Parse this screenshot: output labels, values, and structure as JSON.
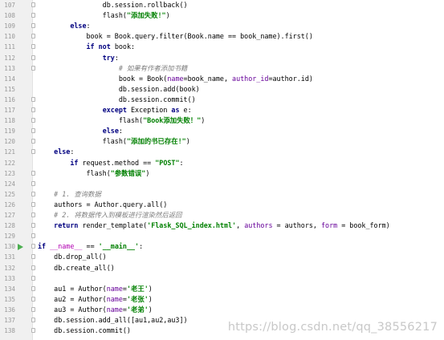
{
  "editor": {
    "lines": [
      {
        "n": "107",
        "tokens": [
          {
            "t": "                db.session.rollback()"
          }
        ]
      },
      {
        "n": "108",
        "tokens": [
          {
            "t": "                flash("
          },
          {
            "t": "\"添加失败!\"",
            "c": "str"
          },
          {
            "t": ")"
          }
        ]
      },
      {
        "n": "109",
        "tokens": [
          {
            "t": "        "
          },
          {
            "t": "else",
            "c": "kw"
          },
          {
            "t": ":"
          }
        ]
      },
      {
        "n": "110",
        "tokens": [
          {
            "t": "            book = Book.query.filter(Book.name == book_name).first()"
          }
        ]
      },
      {
        "n": "111",
        "tokens": [
          {
            "t": "            "
          },
          {
            "t": "if not",
            "c": "kw"
          },
          {
            "t": " book:"
          }
        ]
      },
      {
        "n": "112",
        "tokens": [
          {
            "t": "                "
          },
          {
            "t": "try",
            "c": "kw"
          },
          {
            "t": ":"
          }
        ]
      },
      {
        "n": "113",
        "tokens": [
          {
            "t": "                    "
          },
          {
            "t": "# 如果有作者添加书籍",
            "c": "cmt"
          }
        ]
      },
      {
        "n": "114",
        "tokens": [
          {
            "t": "                    book = Book("
          },
          {
            "t": "name",
            "c": "kwarg"
          },
          {
            "t": "=book_name, "
          },
          {
            "t": "author_id",
            "c": "kwarg"
          },
          {
            "t": "=author.id)"
          }
        ]
      },
      {
        "n": "115",
        "tokens": [
          {
            "t": "                    db.session.add(book)"
          }
        ]
      },
      {
        "n": "116",
        "tokens": [
          {
            "t": "                    db.session.commit()"
          }
        ]
      },
      {
        "n": "117",
        "tokens": [
          {
            "t": "                "
          },
          {
            "t": "except",
            "c": "kw"
          },
          {
            "t": " Exception "
          },
          {
            "t": "as",
            "c": "kw"
          },
          {
            "t": " e:"
          }
        ]
      },
      {
        "n": "118",
        "tokens": [
          {
            "t": "                    flash("
          },
          {
            "t": "\"Book添加失败！\"",
            "c": "str"
          },
          {
            "t": ")"
          }
        ]
      },
      {
        "n": "119",
        "tokens": [
          {
            "t": "                "
          },
          {
            "t": "else",
            "c": "kw"
          },
          {
            "t": ":"
          }
        ]
      },
      {
        "n": "120",
        "tokens": [
          {
            "t": "                flash("
          },
          {
            "t": "\"添加的书已存在!\"",
            "c": "str"
          },
          {
            "t": ")"
          }
        ]
      },
      {
        "n": "121",
        "tokens": [
          {
            "t": "    "
          },
          {
            "t": "else",
            "c": "kw"
          },
          {
            "t": ":"
          }
        ]
      },
      {
        "n": "122",
        "tokens": [
          {
            "t": "        "
          },
          {
            "t": "if",
            "c": "kw"
          },
          {
            "t": " request.method == "
          },
          {
            "t": "\"POST\"",
            "c": "str"
          },
          {
            "t": ":"
          }
        ]
      },
      {
        "n": "123",
        "tokens": [
          {
            "t": "            flash("
          },
          {
            "t": "\"参数错误\"",
            "c": "str"
          },
          {
            "t": ")"
          }
        ]
      },
      {
        "n": "124",
        "tokens": [
          {
            "t": ""
          }
        ]
      },
      {
        "n": "125",
        "tokens": [
          {
            "t": "    "
          },
          {
            "t": "# 1. 查询数据",
            "c": "cmt"
          }
        ]
      },
      {
        "n": "126",
        "tokens": [
          {
            "t": "    authors = Author.query.all()"
          }
        ]
      },
      {
        "n": "127",
        "tokens": [
          {
            "t": "    "
          },
          {
            "t": "# 2. 将数据传入到模板进行渲染然后返回",
            "c": "cmt"
          }
        ]
      },
      {
        "n": "128",
        "tokens": [
          {
            "t": "    "
          },
          {
            "t": "return",
            "c": "kw"
          },
          {
            "t": " render_template("
          },
          {
            "t": "'Flask_SQL_index.html'",
            "c": "str"
          },
          {
            "t": ", "
          },
          {
            "t": "authors",
            "c": "kwarg"
          },
          {
            "t": " = authors, "
          },
          {
            "t": "form",
            "c": "kwarg"
          },
          {
            "t": " = book_form)"
          }
        ]
      },
      {
        "n": "129",
        "tokens": [
          {
            "t": ""
          }
        ]
      },
      {
        "n": "130",
        "tokens": [
          {
            "t": "if",
            "c": "kw"
          },
          {
            "t": " "
          },
          {
            "t": "__name__",
            "c": "dunder"
          },
          {
            "t": " == "
          },
          {
            "t": "'__main__'",
            "c": "str"
          },
          {
            "t": ":"
          }
        ]
      },
      {
        "n": "131",
        "tokens": [
          {
            "t": "    db.drop_all()"
          }
        ]
      },
      {
        "n": "132",
        "tokens": [
          {
            "t": "    db.create_all()"
          }
        ]
      },
      {
        "n": "133",
        "tokens": [
          {
            "t": ""
          }
        ]
      },
      {
        "n": "134",
        "tokens": [
          {
            "t": "    au1 = Author("
          },
          {
            "t": "name",
            "c": "kwarg"
          },
          {
            "t": "="
          },
          {
            "t": "'老王'",
            "c": "str"
          },
          {
            "t": ")"
          }
        ]
      },
      {
        "n": "135",
        "tokens": [
          {
            "t": "    au2 = Author("
          },
          {
            "t": "name",
            "c": "kwarg"
          },
          {
            "t": "="
          },
          {
            "t": "'老张'",
            "c": "str"
          },
          {
            "t": ")"
          }
        ]
      },
      {
        "n": "136",
        "tokens": [
          {
            "t": "    au3 = Author("
          },
          {
            "t": "name",
            "c": "kwarg"
          },
          {
            "t": "="
          },
          {
            "t": "'老弟'",
            "c": "str"
          },
          {
            "t": ")"
          }
        ]
      },
      {
        "n": "137",
        "tokens": [
          {
            "t": "    db.session.add_all([au1,au2,au3])"
          }
        ]
      },
      {
        "n": "138",
        "tokens": [
          {
            "t": "    db.session.commit()"
          }
        ]
      }
    ],
    "run_line": "130",
    "fold_lines": [
      "107",
      "108",
      "109",
      "110",
      "111",
      "112",
      "113",
      "116",
      "117",
      "118",
      "119",
      "120",
      "121",
      "123",
      "124",
      "125",
      "126",
      "127",
      "128",
      "129",
      "130",
      "131",
      "132",
      "133",
      "134",
      "135",
      "136",
      "137",
      "138"
    ]
  },
  "watermark": "https://blog.csdn.net/qq_38556217"
}
